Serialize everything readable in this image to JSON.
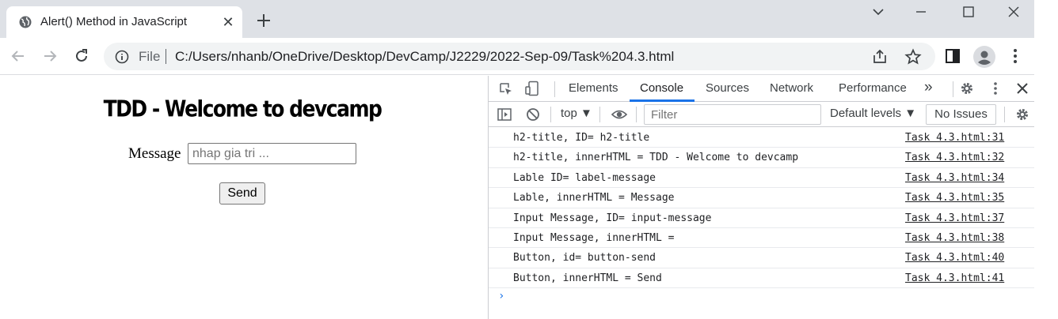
{
  "browser": {
    "tab_title": "Alert() Method in JavaScript",
    "tab_close": "✕",
    "file_label": "File",
    "url": "C:/Users/nhanb/OneDrive/Desktop/DevCamp/J2229/2022-Sep-09/Task%204.3.html"
  },
  "page": {
    "heading": "TDD - Welcome to devcamp",
    "message_label": "Message",
    "message_placeholder": "nhap gia tri ...",
    "send_label": "Send"
  },
  "devtools": {
    "tabs": [
      "Elements",
      "Console",
      "Sources",
      "Network",
      "Performance"
    ],
    "active_tab": "Console",
    "more": "»",
    "context": "top ▼",
    "filter_placeholder": "Filter",
    "levels": "Default levels ▼",
    "issues": "No Issues",
    "logs": [
      {
        "msg": "h2-title, ID= h2-title",
        "src": "Task 4.3.html:31"
      },
      {
        "msg": "h2-title, innerHTML = TDD - Welcome to devcamp",
        "src": "Task 4.3.html:32"
      },
      {
        "msg": "Lable ID= label-message",
        "src": "Task 4.3.html:34"
      },
      {
        "msg": "Lable, innerHTML = Message",
        "src": "Task 4.3.html:35"
      },
      {
        "msg": "Input Message, ID= input-message",
        "src": "Task 4.3.html:37"
      },
      {
        "msg": "Input Message, innerHTML =",
        "src": "Task 4.3.html:38"
      },
      {
        "msg": "Button, id= button-send",
        "src": "Task 4.3.html:40"
      },
      {
        "msg": "Button, innerHTML = Send",
        "src": "Task 4.3.html:41"
      }
    ],
    "prompt": "›"
  },
  "colors": {
    "accent": "#1a73e8",
    "tabstrip": "#dee1e6",
    "omnibox": "#f1f3f4"
  }
}
